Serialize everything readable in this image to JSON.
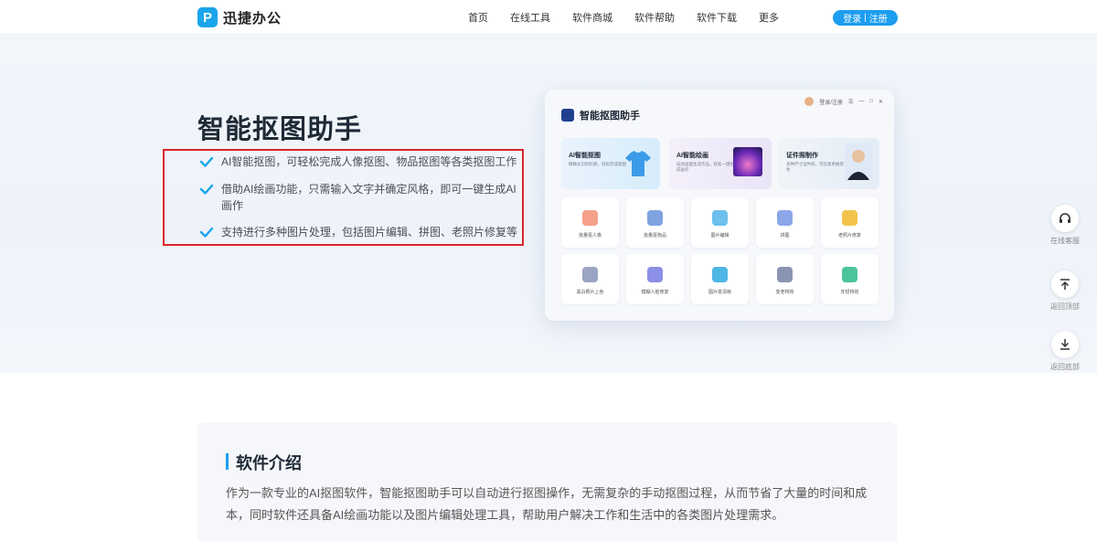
{
  "header": {
    "logo_text": "迅捷办公",
    "nav": [
      "首页",
      "在线工具",
      "软件商城",
      "软件帮助",
      "软件下载",
      "更多"
    ],
    "login_label": "登录",
    "register_label": "注册",
    "separator": "|"
  },
  "hero": {
    "title": "智能抠图助手",
    "features": [
      "AI智能抠图，可轻松完成人像抠图、物品抠图等各类抠图工作",
      "借助AI绘画功能，只需输入文字并确定风格，即可一键生成AI画作",
      "支持进行多种图片处理，包括图片编辑、拼图、老照片修复等"
    ],
    "check_color": "#1aa5ea",
    "highlight_color": "#d8262b"
  },
  "app_preview": {
    "title": "智能抠图助手",
    "top_bar_text": "登录/注册",
    "feature_cards": [
      {
        "title": "AI智能抠图",
        "sub": "精确化识别轮廓，轻松完成抠图"
      },
      {
        "title": "AI智能绘画",
        "sub": "描述画面生成作品，轻松一键生成画作"
      },
      {
        "title": "证件照制作",
        "sub": "多种尺寸证件照，可任意更换底色"
      }
    ],
    "tools": [
      {
        "label": "批量抠人像",
        "color": "#f5a08a"
      },
      {
        "label": "批量抠物品",
        "color": "#7fa3e0"
      },
      {
        "label": "图片编辑",
        "color": "#6dc0ec"
      },
      {
        "label": "拼图",
        "color": "#8ba7e8"
      },
      {
        "label": "老照片修复",
        "color": "#f3c44b"
      },
      {
        "label": "黑白照片上色",
        "color": "#9aa5c3"
      },
      {
        "label": "模糊人脸修复",
        "color": "#8b8fe6"
      },
      {
        "label": "图片变清晰",
        "color": "#4fb7e5"
      },
      {
        "label": "变老特效",
        "color": "#8995b0"
      },
      {
        "label": "年轻特效",
        "color": "#4cc59a"
      }
    ]
  },
  "side": {
    "service": "在线客服",
    "top": "返回顶部",
    "bottom": "返回底部"
  },
  "intro": {
    "title": "软件介绍",
    "text": "作为一款专业的AI抠图软件，智能抠图助手可以自动进行抠图操作，无需复杂的手动抠图过程，从而节省了大量的时间和成本，同时软件还具备AI绘画功能以及图片编辑处理工具，帮助用户解决工作和生活中的各类图片处理需求。"
  },
  "accent_color": "#1b9df0"
}
